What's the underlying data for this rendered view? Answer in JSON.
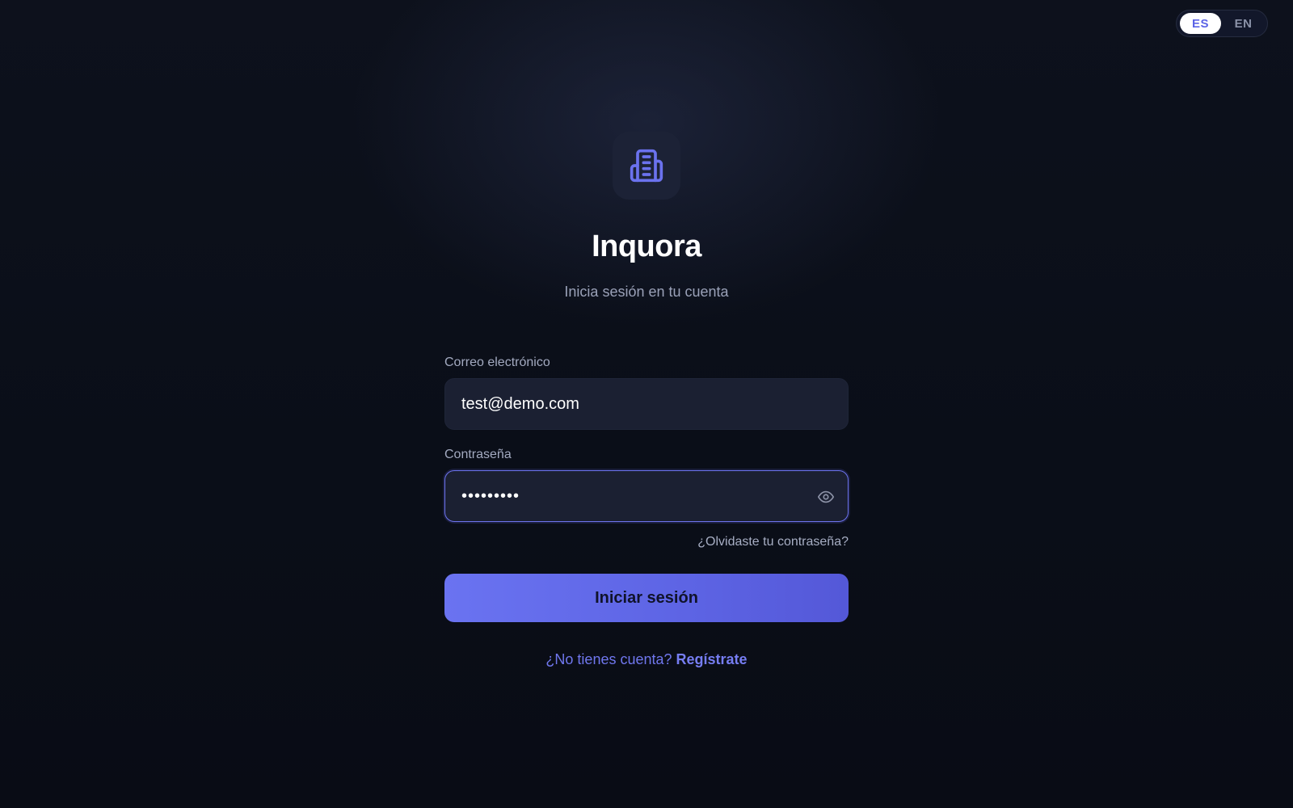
{
  "language_toggle": {
    "options": [
      {
        "code": "ES",
        "active": true
      },
      {
        "code": "EN",
        "active": false
      }
    ]
  },
  "brand": {
    "logo_icon": "building-icon",
    "name": "Inquora",
    "subtitle": "Inicia sesión en tu cuenta"
  },
  "form": {
    "email": {
      "label": "Correo electrónico",
      "value": "test@demo.com"
    },
    "password": {
      "label": "Contraseña",
      "value": "•••••••••",
      "toggle_icon": "eye-icon"
    },
    "forgot_link": "¿Olvidaste tu contraseña?",
    "submit_label": "Iniciar sesión",
    "signup_prompt": "¿No tienes cuenta?",
    "signup_link": "Regístrate"
  },
  "colors": {
    "accent": "#6a73f1",
    "background": "#0b0f1a",
    "input_bg": "#1b2032"
  }
}
